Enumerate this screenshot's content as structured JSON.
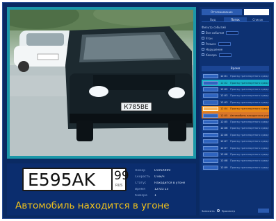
{
  "plate": {
    "number": "E595AK",
    "region": "99",
    "country": "RUS"
  },
  "alert": "Автомобиль находится в угоне",
  "car_plate_text": "К785ВЕ",
  "info": [
    {
      "label": "Номер",
      "value": "E595AK99"
    },
    {
      "label": "Скорость",
      "value": "0 км/ч"
    },
    {
      "label": "Статус",
      "value": "Находится в угоне"
    },
    {
      "label": "Время",
      "value": "12:05:13"
    },
    {
      "label": "Камера",
      "value": "1"
    }
  ],
  "right_panel": {
    "tabs": [
      {
        "label": "Отслеживание"
      }
    ],
    "sub_tabs": [
      {
        "label": "Вид"
      },
      {
        "label": "Поток"
      },
      {
        "label": "Список"
      }
    ],
    "settings": [
      {
        "label": "Фильтр событий"
      },
      {
        "label": "Все события"
      },
      {
        "label": "Угон"
      },
      {
        "label": "Розыск"
      },
      {
        "label": "Нарушение"
      },
      {
        "label": "Камера"
      }
    ],
    "events_header": "Время",
    "events": [
      {
        "time": "12:01",
        "desc": "Проезд транспортного средства",
        "style": "normal"
      },
      {
        "time": "12:02",
        "desc": "Проезд транспортного средства",
        "style": "cyan"
      },
      {
        "time": "12:02",
        "desc": "Проезд транспортного средства",
        "style": "normal"
      },
      {
        "time": "12:03",
        "desc": "Проезд транспортного средства",
        "style": "normal"
      },
      {
        "time": "12:03",
        "desc": "Проезд транспортного средства",
        "style": "normal"
      },
      {
        "time": "12:04",
        "desc": "Проезд транспортного средства",
        "style": "orange"
      },
      {
        "time": "12:05",
        "desc": "Автомобиль находится в угоне",
        "style": "orange-soft"
      },
      {
        "time": "12:05",
        "desc": "Проезд транспортного средства",
        "style": "normal"
      },
      {
        "time": "12:06",
        "desc": "Проезд транспортного средства",
        "style": "normal"
      },
      {
        "time": "12:06",
        "desc": "Проезд транспортного средства",
        "style": "normal"
      },
      {
        "time": "12:07",
        "desc": "Проезд транспортного средства",
        "style": "normal"
      },
      {
        "time": "12:07",
        "desc": "Проезд транспортного средства",
        "style": "normal"
      },
      {
        "time": "12:08",
        "desc": "Проезд транспортного средства",
        "style": "normal"
      },
      {
        "time": "12:08",
        "desc": "Проезд транспортного средства",
        "style": "normal"
      },
      {
        "time": "12:09",
        "desc": "Проезд транспортного средства",
        "style": "normal"
      }
    ],
    "bottom": {
      "left_label": "Записать",
      "mid_label": "Просмотр"
    }
  },
  "colors": {
    "background": "#0a2a63",
    "alert": "#f1c21b",
    "highlight_cyan": "#18b3c7",
    "highlight_orange": "#e9891b"
  }
}
